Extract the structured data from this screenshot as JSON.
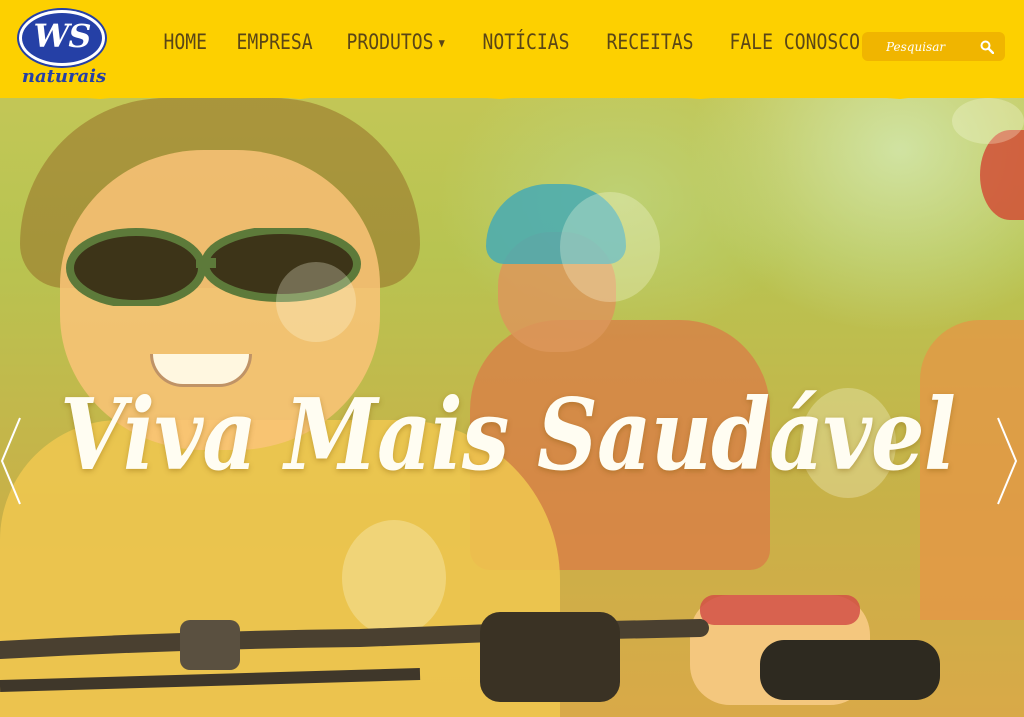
{
  "brand": {
    "logo_text": "WS",
    "logo_sub": "naturais"
  },
  "nav": {
    "items": [
      {
        "label": "HOME"
      },
      {
        "label": "EMPRESA"
      },
      {
        "label": "PRODUTOS",
        "has_dropdown": true
      },
      {
        "label": "NOTÍCIAS"
      },
      {
        "label": "RECEITAS"
      },
      {
        "label": "FALE CONOSCO"
      }
    ]
  },
  "search": {
    "placeholder": "Pesquisar",
    "icon": "search-icon"
  },
  "hero": {
    "title": "Viva Mais Saudável",
    "prev_icon": "chevron-left-icon",
    "next_icon": "chevron-right-icon"
  },
  "colors": {
    "header_bg": "#fdd000",
    "nav_text": "#5a4616",
    "logo_blue": "#2540a6",
    "search_bg": "#f0b500",
    "hero_title": "#fffdf2"
  }
}
